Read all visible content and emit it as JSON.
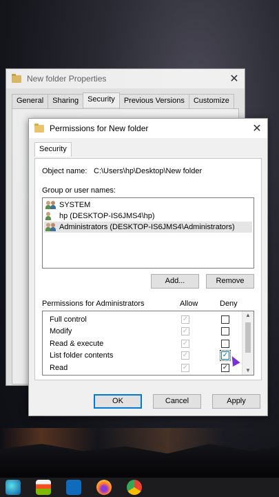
{
  "background_window": {
    "title": "New folder Properties",
    "tabs": [
      "General",
      "Sharing",
      "Security",
      "Previous Versions",
      "Customize"
    ],
    "active_tab": "Security"
  },
  "dialog": {
    "title": "Permissions for New folder",
    "tab": "Security",
    "object_name_label": "Object name:",
    "object_name_value": "C:\\Users\\hp\\Desktop\\New folder",
    "group_label": "Group or user names:",
    "users": [
      "SYSTEM",
      "hp (DESKTOP-IS6JMS4\\hp)",
      "Administrators (DESKTOP-IS6JMS4\\Administrators)"
    ],
    "selected_user": "Administrators (DESKTOP-IS6JMS4\\Administrators)",
    "add_label": "Add...",
    "remove_label": "Remove",
    "permissions_label": "Permissions for Administrators",
    "allow_label": "Allow",
    "deny_label": "Deny",
    "permissions": [
      {
        "name": "Full control",
        "allow": true,
        "deny": false
      },
      {
        "name": "Modify",
        "allow": true,
        "deny": false
      },
      {
        "name": "Read & execute",
        "allow": true,
        "deny": false
      },
      {
        "name": "List folder contents",
        "allow": true,
        "deny": true
      },
      {
        "name": "Read",
        "allow": true,
        "deny": true
      }
    ],
    "ok_label": "OK",
    "cancel_label": "Cancel",
    "apply_label": "Apply"
  },
  "taskbar_icons": [
    "edge-icon",
    "store-icon",
    "mail-icon",
    "firefox-icon",
    "chrome-icon"
  ],
  "colors": {
    "accent": "#0078d7",
    "cursor": "#7b2fd6"
  }
}
